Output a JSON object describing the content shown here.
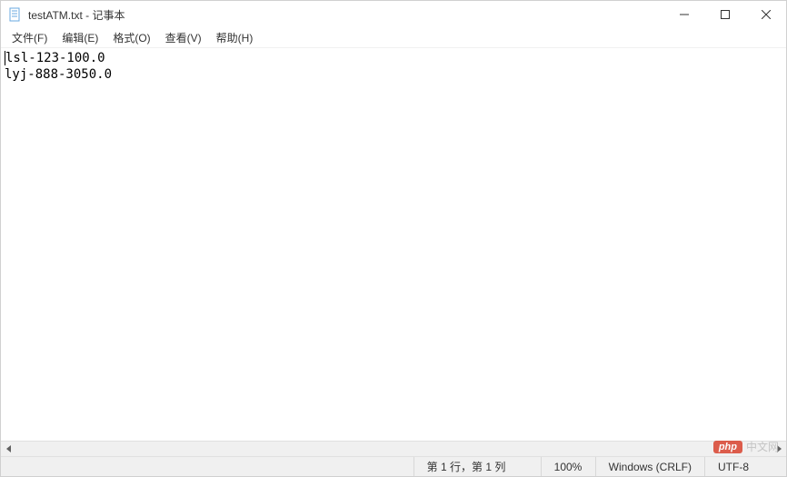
{
  "window": {
    "title": "testATM.txt - 记事本"
  },
  "menu": {
    "file": "文件(F)",
    "edit": "编辑(E)",
    "format": "格式(O)",
    "view": "查看(V)",
    "help": "帮助(H)"
  },
  "content": {
    "line1": "lsl-123-100.0",
    "line2": "lyj-888-3050.0"
  },
  "status": {
    "position": "第 1 行，第 1 列",
    "zoom": "100%",
    "line_ending": "Windows (CRLF)",
    "encoding": "UTF-8"
  },
  "watermark": {
    "badge": "php",
    "text": "中文网"
  }
}
